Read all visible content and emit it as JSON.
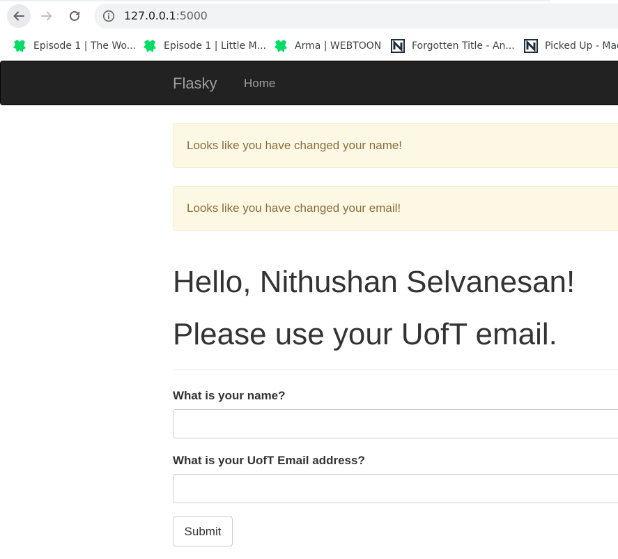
{
  "browser": {
    "url_host": "127.0.0.1",
    "url_port": ":5000",
    "bookmarks": [
      {
        "label": "Episode 1 | The Wo...",
        "icon": "webtoon-icon"
      },
      {
        "label": "Episode 1 | Little M...",
        "icon": "webtoon-icon"
      },
      {
        "label": "Arma | WEBTOON",
        "icon": "webtoon-icon"
      },
      {
        "label": "Forgotten Title - An...",
        "icon": "novelupdates-icon"
      },
      {
        "label": "Picked Up - Mad",
        "icon": "novelupdates-icon"
      }
    ]
  },
  "navbar": {
    "brand": "Flasky",
    "home": "Home"
  },
  "alerts": [
    "Looks like you have changed your name!",
    "Looks like you have changed your email!"
  ],
  "main": {
    "greeting": "Hello, Nithushan Selvanesan!",
    "notice": "Please use your UofT email."
  },
  "form": {
    "name_label": "What is your name?",
    "name_value": "",
    "email_label": "What is your UofT Email address?",
    "email_value": "",
    "submit_label": "Submit"
  },
  "colors": {
    "navbar_bg": "#222222",
    "navbar_text": "#9d9d9d",
    "alert_bg": "#fcf8e3",
    "alert_text": "#8a6d3b",
    "webtoon_green": "#00dc64"
  }
}
